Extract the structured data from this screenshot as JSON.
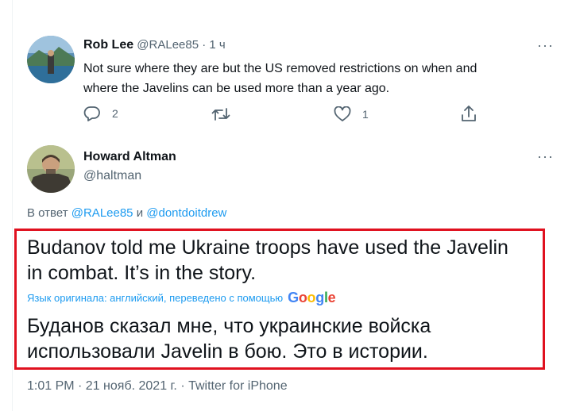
{
  "reply": {
    "author_name": "Rob Lee",
    "author_handle": "@RALee85",
    "separator": "·",
    "time_ago": "1 ч",
    "text_line1": "Not sure where they are but the US removed restrictions on when and",
    "text_line2": "where the Javelins can be used more than a year ago.",
    "actions": {
      "reply_count": "2",
      "retweet_count": "",
      "like_count": "1"
    }
  },
  "main": {
    "author_name": "Howard Altman",
    "author_handle": "@haltman",
    "replying_prefix": "В ответ",
    "reply_to_1": "@RALee85",
    "reply_conj": "и",
    "reply_to_2": "@dontdoitdrew",
    "text_line1": "Budanov told me Ukraine troops have used the Javelin",
    "text_line2": "in combat. It’s in the story.",
    "translation_label": "Язык оригинала: английский, переведено с помощью",
    "translation_provider": "Google",
    "translated_line1": "Буданов сказал мне, что украинские войска",
    "translated_line2": "использовали Javelin в бою. Это в истории.",
    "timestamp": "1:01 PM · 21 нояб. 2021 г. · Twitter for iPhone",
    "highlight_color": "#e0111f"
  },
  "colors": {
    "accent": "#1d9bf0",
    "muted": "#536471",
    "text": "#0f1419"
  },
  "icons": [
    "more-icon",
    "reply-icon",
    "retweet-icon",
    "like-icon",
    "share-icon"
  ]
}
